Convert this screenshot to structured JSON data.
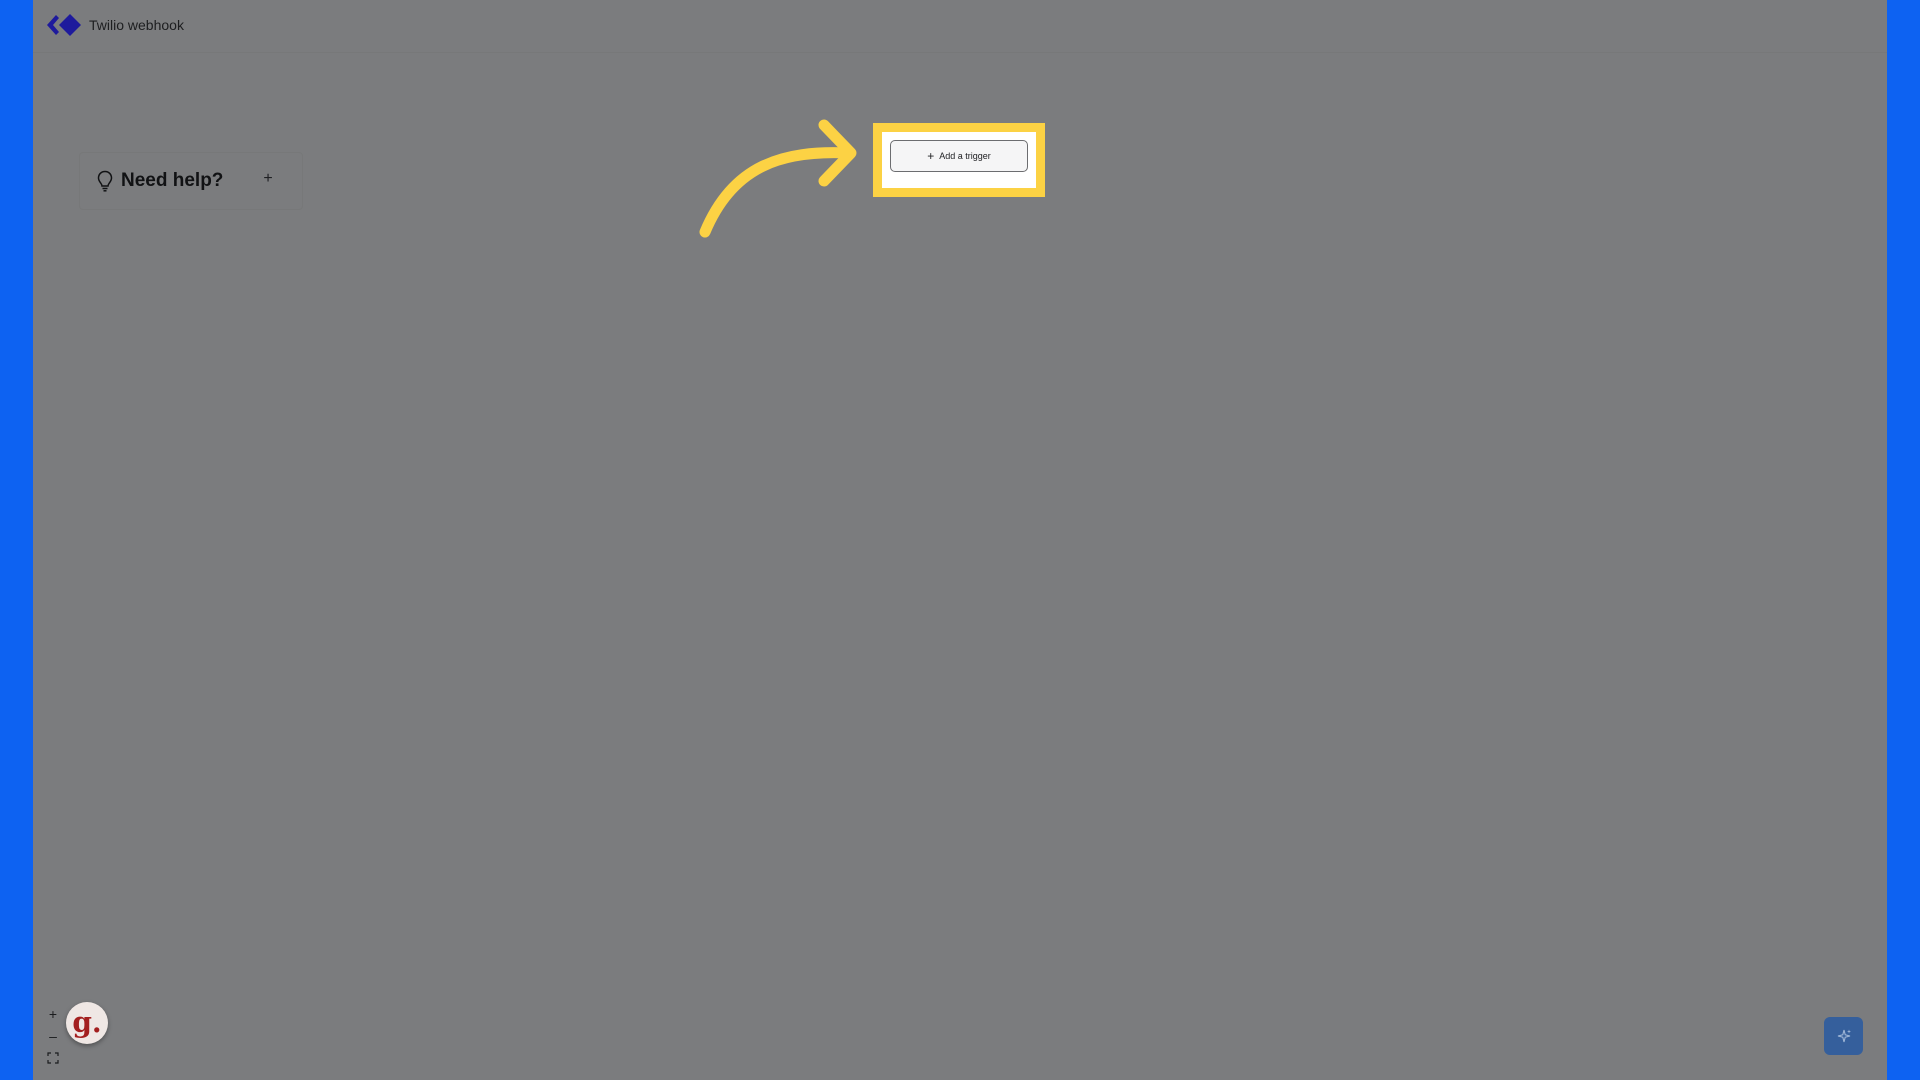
{
  "header": {
    "title": "Twilio webhook",
    "logo_icon": "double-chevron-logo-icon"
  },
  "help_panel": {
    "title": "Need help?",
    "icon": "lightbulb-icon",
    "expand_label": "+"
  },
  "canvas": {
    "trigger_button_label": "Add a trigger",
    "trigger_icon": "plus-icon"
  },
  "zoom": {
    "zoom_in_label": "+",
    "zoom_out_label": "–"
  },
  "badge": {
    "letter": "g."
  },
  "colors": {
    "frame": "#0d62f2",
    "canvas_overlay": "#7b7c7e",
    "highlight": "#fcd244",
    "logo": "#1e1a9c",
    "assist_button": "#355f9c"
  }
}
